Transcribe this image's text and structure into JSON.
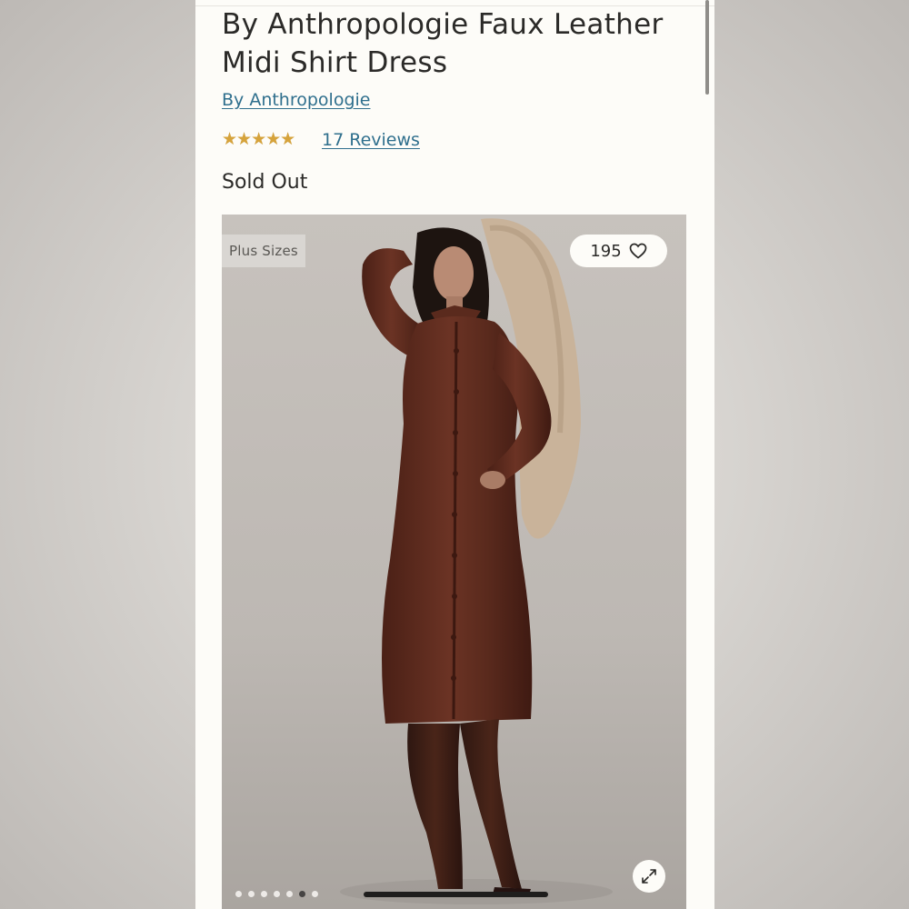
{
  "product": {
    "title": "By Anthropologie Faux Leather Midi Shirt Dress",
    "brand_link": "By Anthropologie",
    "rating": 4.5,
    "rating_max": 5,
    "reviews_link": "17 Reviews",
    "availability": "Sold Out"
  },
  "gallery": {
    "tag": "Plus Sizes",
    "favorite_count": "195",
    "favorite_icon": "heart-icon",
    "expand_icon": "expand-icon",
    "slide_count": 7,
    "active_slide": 6,
    "image_alt": "Model wearing a brown faux leather midi shirt dress with knee-high boots"
  },
  "colors": {
    "page_bg": "#fdfcf8",
    "text": "#2b2a28",
    "link": "#2f6f8d",
    "star": "#d6a33b",
    "dress": "#5a2a1d",
    "boots": "#3a1d16",
    "coat": "#c9b39a"
  }
}
